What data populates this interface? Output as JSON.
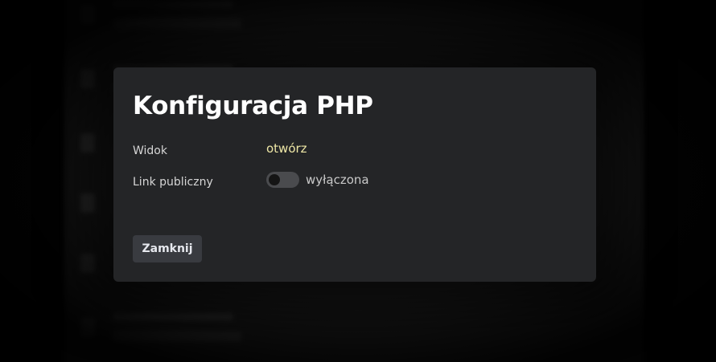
{
  "dialog": {
    "title": "Konfiguracja PHP",
    "rows": {
      "view": {
        "label": "Widok",
        "link_text": "otwórz"
      },
      "public_link": {
        "label": "Link publiczny",
        "toggle_on": false,
        "state_text": "wyłączona"
      }
    },
    "close_label": "Zamknij"
  },
  "colors": {
    "dialog_bg": "#242527",
    "link": "#eee7a6",
    "button_bg": "#393b40"
  },
  "icons": {
    "background_items": "file-icon"
  }
}
